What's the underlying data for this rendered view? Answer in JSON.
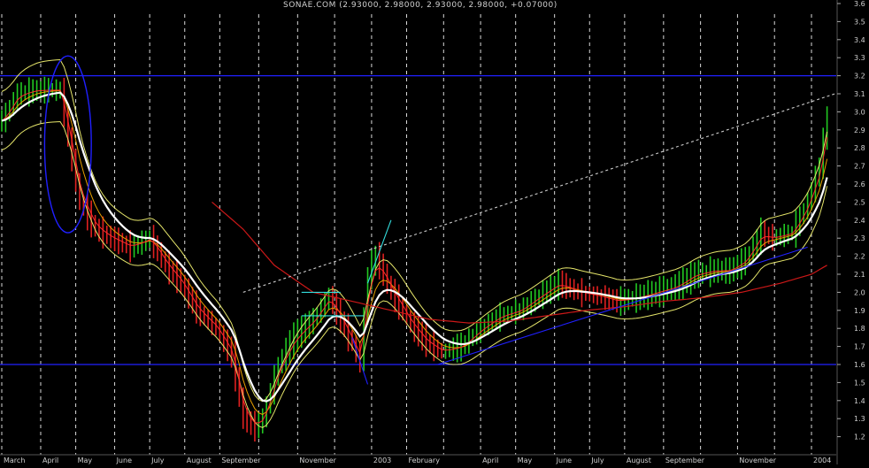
{
  "title": "SONAE.COM (2.93000, 2.98000, 2.93000, 2.98000, +0.07000)",
  "colors": {
    "background": "#000000",
    "grid": "#ffffff",
    "axis_text": "#d0d0d0",
    "candles": "#22c922",
    "candles_down": "#e02020",
    "ma_fast": "#ff2a2a",
    "ma_mid": "#ffcc00",
    "ma_slow": "#ffffff",
    "band": "#e5e56a",
    "long_ma": "#cc1818",
    "trendline": "#2020ff",
    "channel": "#cccccc",
    "cyan": "#33dddd"
  },
  "chart_data": {
    "type": "line",
    "y_ticks": [
      "3.6",
      "3.5",
      "3.4",
      "3.3",
      "3.2",
      "3.1",
      "3.0",
      "2.9",
      "2.8",
      "2.7",
      "2.6",
      "2.5",
      "2.4",
      "2.3",
      "2.2",
      "2.1",
      "2.0",
      "1.9",
      "1.8",
      "1.7",
      "1.6",
      "1.5",
      "1.4",
      "1.3",
      "1.2"
    ],
    "ylim": [
      1.1,
      3.6
    ],
    "x_tick_labels": [
      "March",
      "April",
      "May",
      "June",
      "July",
      "August",
      "September",
      "November",
      "2003",
      "February",
      "April",
      "May",
      "June",
      "July",
      "August",
      "September",
      "November",
      "2004"
    ],
    "x_tick_index": [
      0,
      10,
      19,
      29,
      38,
      47,
      56,
      76,
      95,
      104,
      123,
      132,
      142,
      151,
      160,
      170,
      189,
      208
    ],
    "n_weeks": 214,
    "horizontal_lines": [
      3.2,
      1.6
    ],
    "price_anchors": [
      [
        0,
        2.95
      ],
      [
        4,
        3.1
      ],
      [
        9,
        3.12
      ],
      [
        15,
        3.12
      ],
      [
        17,
        2.85
      ],
      [
        20,
        2.5
      ],
      [
        24,
        2.35
      ],
      [
        28,
        2.3
      ],
      [
        33,
        2.25
      ],
      [
        38,
        2.3
      ],
      [
        42,
        2.15
      ],
      [
        46,
        2.05
      ],
      [
        50,
        1.9
      ],
      [
        55,
        1.8
      ],
      [
        59,
        1.65
      ],
      [
        62,
        1.3
      ],
      [
        65,
        1.25
      ],
      [
        67,
        1.3
      ],
      [
        71,
        1.6
      ],
      [
        75,
        1.75
      ],
      [
        80,
        1.85
      ],
      [
        84,
        1.98
      ],
      [
        88,
        1.8
      ],
      [
        92,
        1.62
      ],
      [
        94,
        2.1
      ],
      [
        96,
        2.2
      ],
      [
        100,
        2.0
      ],
      [
        105,
        1.82
      ],
      [
        109,
        1.72
      ],
      [
        113,
        1.67
      ],
      [
        118,
        1.7
      ],
      [
        123,
        1.8
      ],
      [
        128,
        1.87
      ],
      [
        133,
        1.9
      ],
      [
        138,
        1.98
      ],
      [
        143,
        2.05
      ],
      [
        148,
        2.0
      ],
      [
        153,
        1.98
      ],
      [
        158,
        1.95
      ],
      [
        163,
        1.97
      ],
      [
        168,
        2.0
      ],
      [
        173,
        2.03
      ],
      [
        178,
        2.1
      ],
      [
        183,
        2.12
      ],
      [
        187,
        2.12
      ],
      [
        191,
        2.18
      ],
      [
        195,
        2.33
      ],
      [
        198,
        2.3
      ],
      [
        203,
        2.33
      ],
      [
        207,
        2.5
      ],
      [
        210,
        2.7
      ],
      [
        212,
        2.98
      ]
    ],
    "long_ma_anchors": [
      [
        54,
        2.5
      ],
      [
        62,
        2.35
      ],
      [
        70,
        2.15
      ],
      [
        80,
        2.0
      ],
      [
        90,
        1.95
      ],
      [
        100,
        1.9
      ],
      [
        110,
        1.85
      ],
      [
        120,
        1.83
      ],
      [
        130,
        1.84
      ],
      [
        140,
        1.87
      ],
      [
        150,
        1.9
      ],
      [
        160,
        1.92
      ],
      [
        170,
        1.95
      ],
      [
        180,
        1.97
      ],
      [
        190,
        2.0
      ],
      [
        200,
        2.05
      ],
      [
        208,
        2.1
      ],
      [
        212,
        2.15
      ]
    ],
    "trendlines": [
      {
        "color": "#cccccc",
        "dash": true,
        "from": [
          62,
          2.0
        ],
        "to": [
          214,
          3.1
        ]
      },
      {
        "color": "#2020ff",
        "dash": false,
        "from": [
          112,
          1.6
        ],
        "to": [
          207,
          2.25
        ]
      },
      {
        "color": "#2020ff",
        "dash": false,
        "from": [
          90,
          1.75
        ],
        "to": [
          94,
          1.49
        ]
      },
      {
        "color": "#33dddd",
        "dash": false,
        "from": [
          77,
          2.0
        ],
        "to": [
          87,
          2.0
        ]
      },
      {
        "color": "#33dddd",
        "dash": false,
        "from": [
          77,
          1.87
        ],
        "to": [
          93,
          1.87
        ]
      },
      {
        "color": "#33dddd",
        "dash": false,
        "from": [
          94,
          2.05
        ],
        "to": [
          100,
          2.4
        ]
      }
    ],
    "ellipse": {
      "color": "#2020ff",
      "cx_week": 17,
      "cy_price": 2.82,
      "rx_weeks": 6,
      "ry_price": 0.49
    },
    "grid": true
  }
}
